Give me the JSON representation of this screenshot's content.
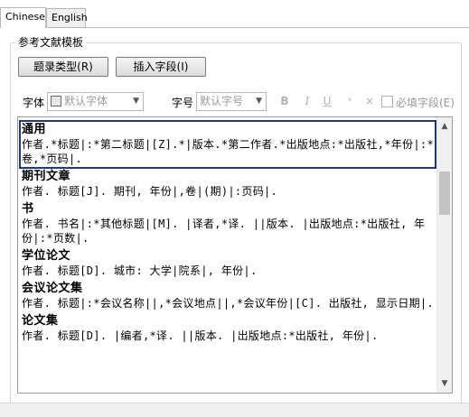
{
  "tabs": [
    {
      "label": "Chinese",
      "active": true
    },
    {
      "label": "English",
      "active": false
    }
  ],
  "group": {
    "title": "参考文献模板"
  },
  "buttons": {
    "entry_type": "题录类型(R)",
    "insert_field": "插入字段(I)"
  },
  "format": {
    "font_label": "字体",
    "font_value": "默认字体",
    "size_label": "字号",
    "size_value": "默认字号",
    "bold": "B",
    "italic": "I",
    "underline": "U",
    "superscript": "ˣ",
    "clear": "×",
    "required_label": "必填字段(E)",
    "required_checked": false
  },
  "entries": [
    {
      "title": "通用",
      "body": "作者.*标题|:*第二标题|[Z].*|版本.*第二作者.*出版地点:*出版社,*年份|:*卷,*页码|."
    },
    {
      "title": "期刊文章",
      "body": "作者. 标题[J]. 期刊, 年份|,卷|(期)|:页码|."
    },
    {
      "title": "书",
      "body": "作者. 书名|:*其他标题|[M]. |译者,*译. ||版本. |出版地点:*出版社, 年份|:*页数|."
    },
    {
      "title": "学位论文",
      "body": "作者. 标题[D]. 城市: 大学|院系|, 年份|."
    },
    {
      "title": "会议论文集",
      "body": "作者. 标题|:*会议名称||,*会议地点||,*会议年份|[C]. 出版社, 显示日期|."
    },
    {
      "title": "论文集",
      "body": "作者. 标题[D]. |编者,*译. ||版本. |出版地点:*出版社, 年份|."
    }
  ],
  "colors": {
    "selection_border": "#1f3a7a"
  },
  "icons": {
    "scroll_up": "chevron-up-icon",
    "scroll_down": "chevron-down-icon"
  }
}
